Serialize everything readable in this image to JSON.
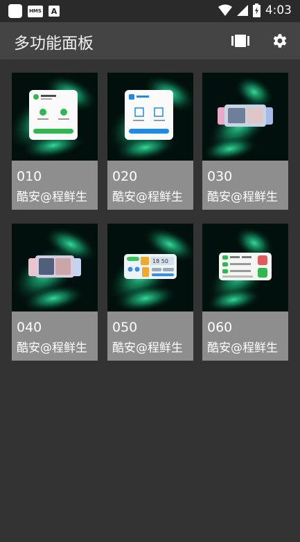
{
  "status_bar": {
    "time": "4:03",
    "left_icons": [
      "square-app-icon",
      "hms-icon",
      "a-icon"
    ],
    "hms_text": "HMS",
    "a_text": "A",
    "right_icons": [
      "wifi-icon",
      "signal-icon",
      "battery-charging-icon"
    ]
  },
  "app_bar": {
    "title": "多功能面板",
    "actions": [
      "carousel-view-icon",
      "settings-gear-icon"
    ]
  },
  "panels": [
    {
      "number": "010",
      "author": "酷安@程鲜生"
    },
    {
      "number": "020",
      "author": "酷安@程鲜生"
    },
    {
      "number": "030",
      "author": "酷安@程鲜生"
    },
    {
      "number": "040",
      "author": "酷安@程鲜生"
    },
    {
      "number": "050",
      "author": "酷安@程鲜生"
    },
    {
      "number": "060",
      "author": "酷安@程鲜生"
    }
  ],
  "colors": {
    "background": "#333333",
    "app_bar": "#444444",
    "card_label": "#8e8e8e",
    "aurora": "#1fcf8a"
  }
}
